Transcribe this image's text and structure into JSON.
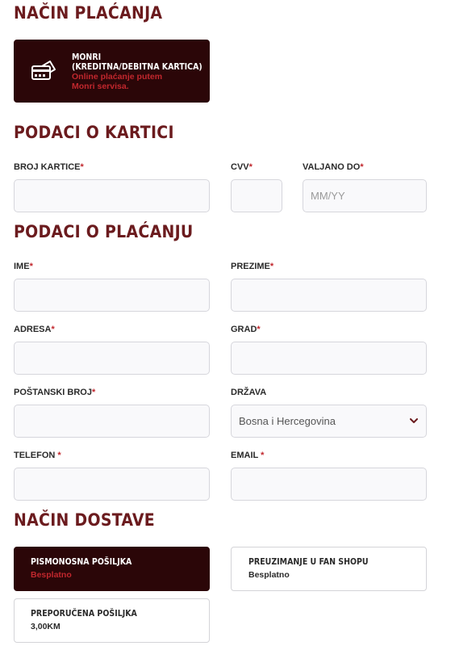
{
  "payment_method": {
    "heading": "NAČIN PLAĆANJA",
    "option": {
      "title_line1": "MONRI",
      "title_line2": "(KREDITNA/DEBITNA KARTICA)",
      "desc_line1": "Online plaćanje putem",
      "desc_line2": "Monri servisa.",
      "icon": "credit-card-icon",
      "selected": true
    }
  },
  "card_details": {
    "heading": "PODACI O KARTICI",
    "card_number": {
      "label": "BROJ KARTICE",
      "required": "*",
      "value": "",
      "placeholder": ""
    },
    "cvv": {
      "label": "CVV",
      "required": "*",
      "value": "",
      "placeholder": ""
    },
    "valid_until": {
      "label": "VALJANO DO",
      "required": "*",
      "value": "",
      "placeholder": "MM/YY"
    }
  },
  "billing": {
    "heading": "PODACI O PLAĆANJU",
    "first_name": {
      "label": "IME",
      "required": "*"
    },
    "last_name": {
      "label": "PREZIME",
      "required": "*"
    },
    "address": {
      "label": "ADRESA",
      "required": "*"
    },
    "city": {
      "label": "GRAD",
      "required": "*"
    },
    "postal_code": {
      "label": "POŠTANSKI BROJ",
      "required": "*"
    },
    "country": {
      "label": "DRŽAVA",
      "value": "Bosna i Hercegovina"
    },
    "phone": {
      "label": "TELEFON",
      "required": " *"
    },
    "email": {
      "label": "EMAIL",
      "required": " *"
    }
  },
  "delivery": {
    "heading": "NAČIN DOSTAVE",
    "options": [
      {
        "title": "PISMONOSNA POŠILJKA",
        "price": "Besplatno",
        "selected": true
      },
      {
        "title": "PREUZIMANJE U FAN SHOPU",
        "price": "Besplatno",
        "selected": false
      },
      {
        "title": "PREPORUČENA POŠILJKA",
        "price": "3,00KM",
        "selected": false
      }
    ]
  },
  "colors": {
    "heading": "#6b1b1e",
    "selected_bg": "#2b0608",
    "accent_red": "#c1272d"
  }
}
